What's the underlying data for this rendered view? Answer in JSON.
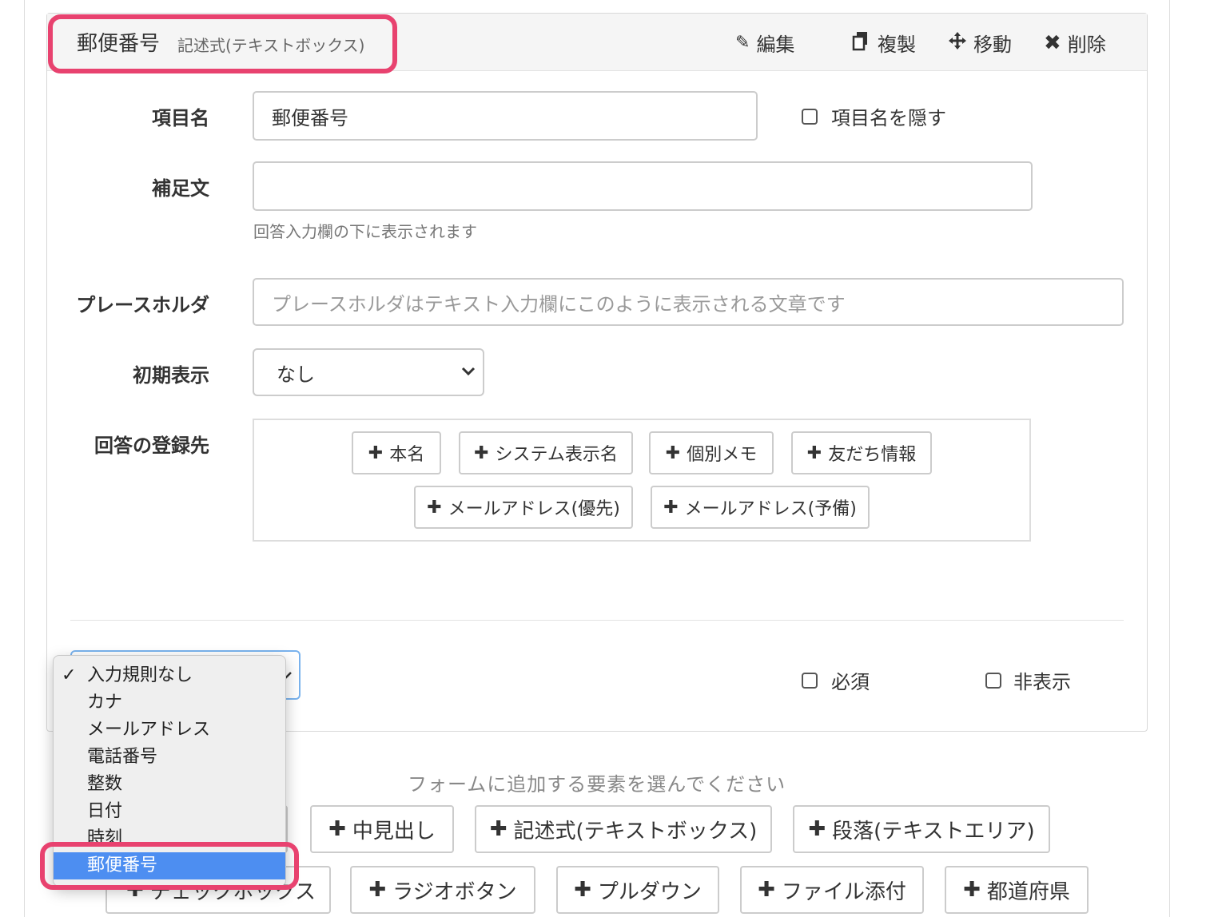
{
  "field": {
    "title": "郵便番号",
    "subtitle": "記述式(テキストボックス)"
  },
  "header_actions": {
    "edit": "編集",
    "copy": "複製",
    "move": "移動",
    "delete": "削除"
  },
  "form": {
    "item_name_label": "項目名",
    "item_name_value": "郵便番号",
    "hide_name_label": "項目名を隠す",
    "supplement_label": "補足文",
    "supplement_value": "",
    "supplement_help": "回答入力欄の下に表示されます",
    "placeholder_label": "プレースホルダ",
    "placeholder_hint": "プレースホルダはテキスト入力欄にこのように表示される文章です",
    "initial_label": "初期表示",
    "initial_value": "なし",
    "dest_label": "回答の登録先",
    "dest_buttons": [
      "本名",
      "システム表示名",
      "個別メモ",
      "友だち情報",
      "メールアドレス(優先)",
      "メールアドレス(予備)"
    ],
    "required_label": "必須",
    "hidden_label": "非表示"
  },
  "rule_dropdown": {
    "options": [
      "入力規則なし",
      "カナ",
      "メールアドレス",
      "電話番号",
      "整数",
      "日付",
      "時刻",
      "郵便番号"
    ],
    "checked_index": 0,
    "highlighted_index": 7,
    "check_mark": "✓"
  },
  "add_section": {
    "caption": "フォームに追加する要素を選んでください",
    "row1": [
      "中見出し",
      "記述式(テキストボックス)",
      "段落(テキストエリア)"
    ],
    "row2": [
      "チェックボックス",
      "ラジオボタン",
      "プルダウン",
      "ファイル添付",
      "都道府県"
    ]
  },
  "icons": {
    "edit": "pencil-icon",
    "copy": "copy-icon",
    "move": "move-arrows-icon",
    "delete": "close-x-icon",
    "plus": "plus-icon",
    "chevron": "chevron-down-icon"
  },
  "colors": {
    "highlight": "#e8426f",
    "selected_option": "#4d8ef1",
    "focus_border": "#7ab3ee"
  }
}
